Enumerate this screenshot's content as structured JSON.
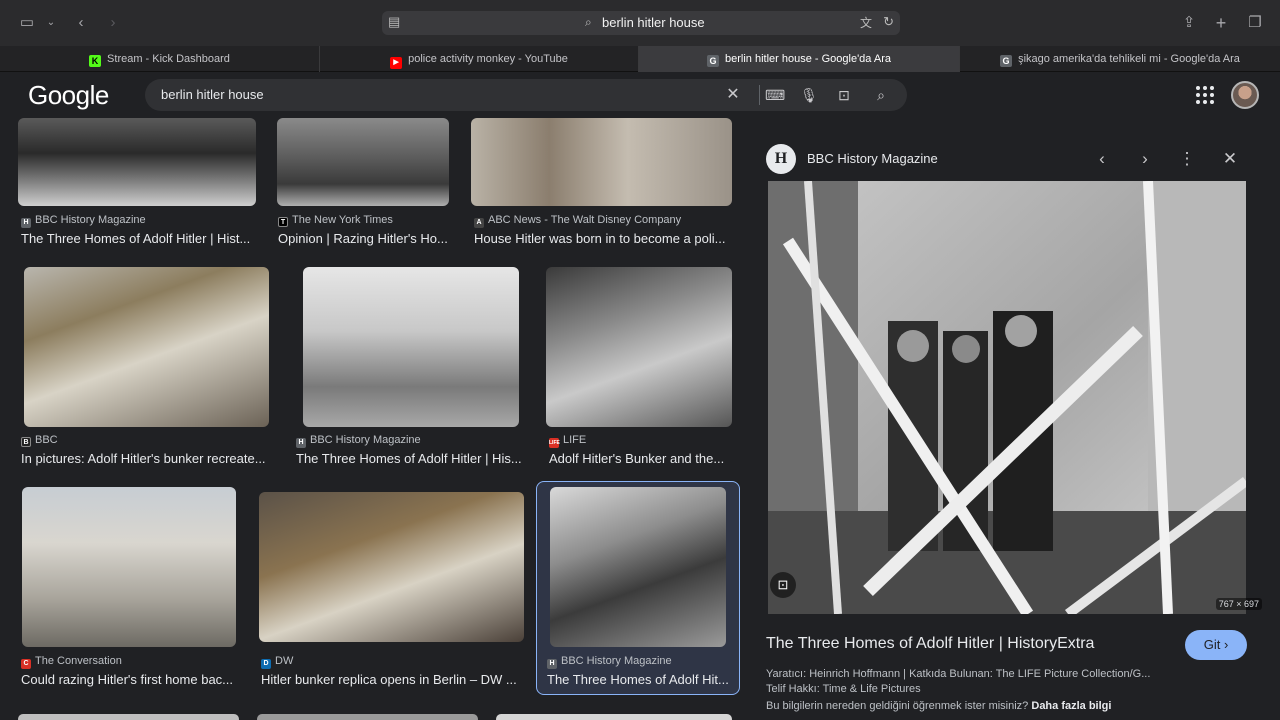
{
  "browser": {
    "url_query": "berlin hitler house",
    "tabs": [
      {
        "label": "Stream - Kick Dashboard",
        "favicon": "K"
      },
      {
        "label": "police activity monkey - YouTube",
        "favicon": "▶"
      },
      {
        "label": "berlin hitler house - Google'da Ara",
        "favicon": "G"
      },
      {
        "label": "şikago amerika'da tehlikeli mi - Google'da Ara",
        "favicon": "G"
      }
    ]
  },
  "google": {
    "logo": "Google",
    "query": "berlin hitler house"
  },
  "results": [
    {
      "source": "BBC History Magazine",
      "title": "The Three Homes of Adolf Hitler | Hist..."
    },
    {
      "source": "The New York Times",
      "title": "Opinion | Razing Hitler's Ho..."
    },
    {
      "source": "ABC News - The Walt Disney Company",
      "title": "House Hitler was born in to become a poli..."
    },
    {
      "source": "BBC",
      "title": "In pictures: Adolf Hitler's bunker recreate..."
    },
    {
      "source": "BBC History Magazine",
      "title": "The Three Homes of Adolf Hitler | His..."
    },
    {
      "source": "LIFE",
      "title": "Adolf Hitler's Bunker and the..."
    },
    {
      "source": "The Conversation",
      "title": "Could razing Hitler's first home bac..."
    },
    {
      "source": "DW",
      "title": "Hitler bunker replica opens in Berlin – DW ..."
    },
    {
      "source": "BBC History Magazine",
      "title": "The Three Homes of Adolf Hit..."
    }
  ],
  "panel": {
    "source": "BBC History Magazine",
    "logo_letter": "H",
    "dimensions": "767 × 697",
    "title": "The Three Homes of Adolf Hitler | HistoryExtra",
    "visit_button": "Git",
    "creator": "Yaratıcı: Heinrich Hoffmann | Katkıda Bulunan: The LIFE Picture Collection/G...",
    "copyright": "Telif Hakkı: Time & Life Pictures",
    "info_question": "Bu bilgilerin nereden geldiğini öğrenmek ister misiniz?",
    "info_link": "Daha fazla bilgi"
  }
}
